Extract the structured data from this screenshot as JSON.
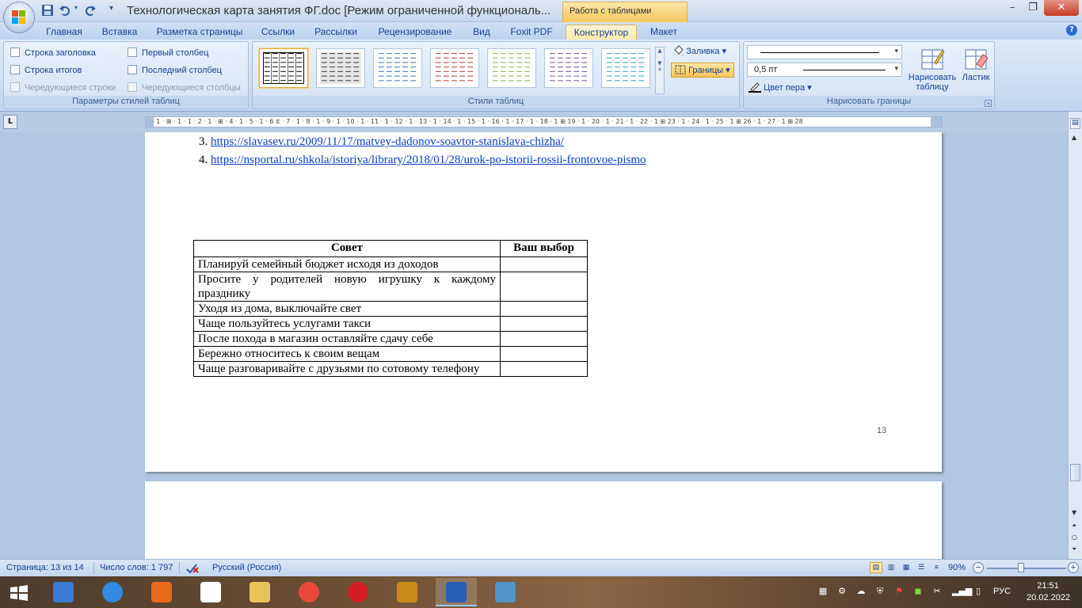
{
  "titlebar": {
    "title": "Технологическая карта занятия ФГ.doc [Режим ограниченной функциональ...",
    "context_tab": "Работа с таблицами",
    "minimize": "–",
    "restore": "❐",
    "close": "✕"
  },
  "tabs": [
    "Главная",
    "Вставка",
    "Разметка страницы",
    "Ссылки",
    "Рассылки",
    "Рецензирование",
    "Вид",
    "Foxit PDF",
    "Конструктор",
    "Макет"
  ],
  "active_tab": "Конструктор",
  "ribbon": {
    "style_options": {
      "label": "Параметры стилей таблиц",
      "items": [
        {
          "label": "Строка заголовка",
          "enabled": true
        },
        {
          "label": "Первый столбец",
          "enabled": true
        },
        {
          "label": "Строка итогов",
          "enabled": true
        },
        {
          "label": "Последний столбец",
          "enabled": true
        },
        {
          "label": "Чередующиеся строки",
          "enabled": false
        },
        {
          "label": "Чередующиеся столбцы",
          "enabled": false
        }
      ]
    },
    "table_styles": {
      "label": "Стили таблиц",
      "thumb_colors": [
        "#000000",
        "#4a4a4a",
        "#4f81bd",
        "#c0504d",
        "#9bbb59",
        "#8064a2",
        "#4bacc6"
      ],
      "selected_index": 0,
      "shading_label": "Заливка",
      "borders_label": "Границы"
    },
    "draw_borders": {
      "label": "Нарисовать границы",
      "line_weight": "0,5 пт",
      "pen_color_label": "Цвет пера",
      "draw_table_label": "Нарисовать таблицу",
      "eraser_label": "Ластик"
    }
  },
  "ruler": {
    "corner": "L",
    "ticks": "· 1 · ⊞ · 1 · 1 · 2 · 1 · ⊞ · 4 · 1 · 5 · 1 · 6 ⧖ · 7 · 1 · 8 · 1 · 9 · 1 · 10 · 1 · 11 · 1 · 12 · 1 · 13 · 1 · 14 · 1 · 15 · 1 · 16 · 1 · 17 · 1 · 18 · 1 ⊞ 19 · 1 · 20 · 1 · 21 · 1 · 22 · 1 ⊞ 23 · 1 · 24 · 1 · 25 · 1 ⊞ 26 · 1 · 27 · 1 ⊞ 28"
  },
  "document": {
    "references": [
      {
        "number": "3.",
        "url": "https://slavasev.ru/2009/11/17/matvey-dadonov-soavtor-stanislava-chizha/"
      },
      {
        "number": "4.",
        "url": "https://nsportal.ru/shkola/istoriya/library/2018/01/28/urok-po-istorii-rossii-frontovoe-pismo"
      }
    ],
    "table": {
      "headers": [
        "Совет",
        "Ваш выбор"
      ],
      "rows": [
        "Планируй семейный бюджет исходя из доходов",
        "Просите у родителей новую игрушку к каждому празднику",
        "Уходя из дома, выключайте свет",
        "Чаще пользуйтесь услугами такси",
        "После похода в магазин оставляйте сдачу себе",
        "Бережно относитесь к своим вещам",
        "Чаще разговаривайте с друзьями по сотовому телефону"
      ]
    },
    "page_number": "13"
  },
  "statusbar": {
    "page": "Страница: 13 из 14",
    "words": "Число слов: 1 797",
    "language": "Русский (Россия)",
    "zoom": "90%"
  },
  "taskbar": {
    "apps": [
      {
        "name": "speaker",
        "color": "#3a7bd5"
      },
      {
        "name": "internet-explorer",
        "color": "#2f8ae0"
      },
      {
        "name": "media-player",
        "color": "#e86a1c"
      },
      {
        "name": "yandex-browser",
        "color": "#ffffff"
      },
      {
        "name": "file-explorer",
        "color": "#e8c35a"
      },
      {
        "name": "chrome",
        "color": "#e8493a"
      },
      {
        "name": "opera",
        "color": "#d31e26"
      },
      {
        "name": "pdf-reader",
        "color": "#c98b16"
      },
      {
        "name": "word",
        "color": "#2b5fb5"
      },
      {
        "name": "image-viewer",
        "color": "#4f95c9"
      }
    ],
    "language": "РУС",
    "time": "21:51",
    "date": "20.02.2022"
  }
}
